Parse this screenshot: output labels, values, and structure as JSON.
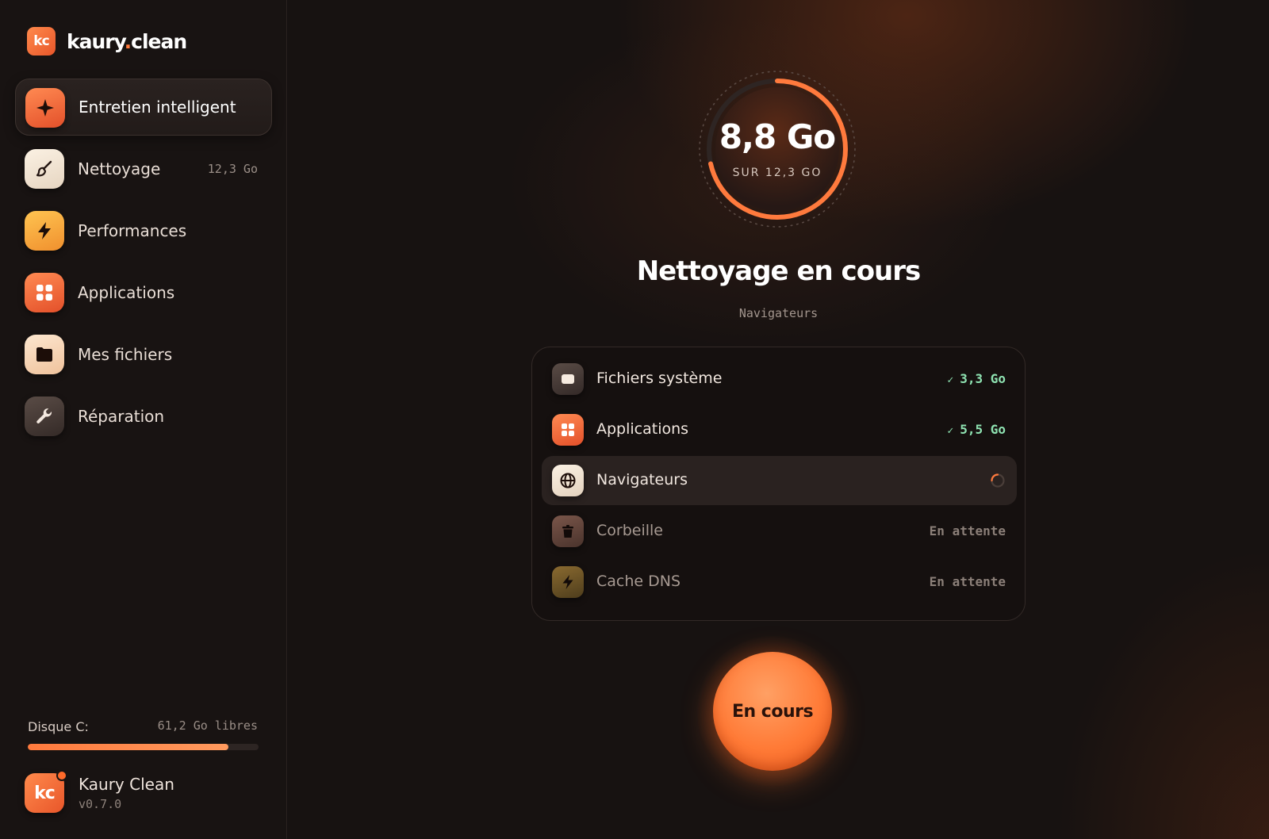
{
  "brand": {
    "logo": "kc",
    "name_part1": "kaury",
    "name_dot": ".",
    "name_part2": "clean"
  },
  "sidebar": {
    "items": [
      {
        "label": "Entretien intelligent",
        "icon": "sparkle-icon",
        "active": true,
        "meta": ""
      },
      {
        "label": "Nettoyage",
        "icon": "brush-icon",
        "active": false,
        "meta": "12,3 Go"
      },
      {
        "label": "Performances",
        "icon": "lightning-icon",
        "active": false,
        "meta": ""
      },
      {
        "label": "Applications",
        "icon": "apps-grid-icon",
        "active": false,
        "meta": ""
      },
      {
        "label": "Mes fichiers",
        "icon": "folder-icon",
        "active": false,
        "meta": ""
      },
      {
        "label": "Réparation",
        "icon": "wrench-icon",
        "active": false,
        "meta": ""
      }
    ],
    "disk": {
      "label": "Disque C:",
      "free": "61,2 Go libres",
      "used_fraction": 0.87
    },
    "user": {
      "avatar": "kc",
      "name": "Kaury Clean",
      "version": "v0.7.0"
    }
  },
  "main": {
    "progress": {
      "value": "8,8 Go",
      "sub": "SUR 12,3 GO",
      "fraction": 0.715
    },
    "title": "Nettoyage en cours",
    "current_step": "Navigateurs",
    "tasks": [
      {
        "label": "Fichiers système",
        "icon": "window-icon",
        "state": "done",
        "status": "3,3 Go",
        "check": "✓"
      },
      {
        "label": "Applications",
        "icon": "apps-grid-icon",
        "state": "done",
        "status": "5,5 Go",
        "check": "✓"
      },
      {
        "label": "Navigateurs",
        "icon": "globe-icon",
        "state": "running",
        "status": ""
      },
      {
        "label": "Corbeille",
        "icon": "trash-icon",
        "state": "pending",
        "status": "En attente"
      },
      {
        "label": "Cache DNS",
        "icon": "lightning-icon",
        "state": "pending",
        "status": "En attente"
      }
    ],
    "cta_label": "En cours"
  },
  "colors": {
    "accent": "#ff7a3d",
    "done": "#8fe3b2",
    "background": "#171211"
  }
}
